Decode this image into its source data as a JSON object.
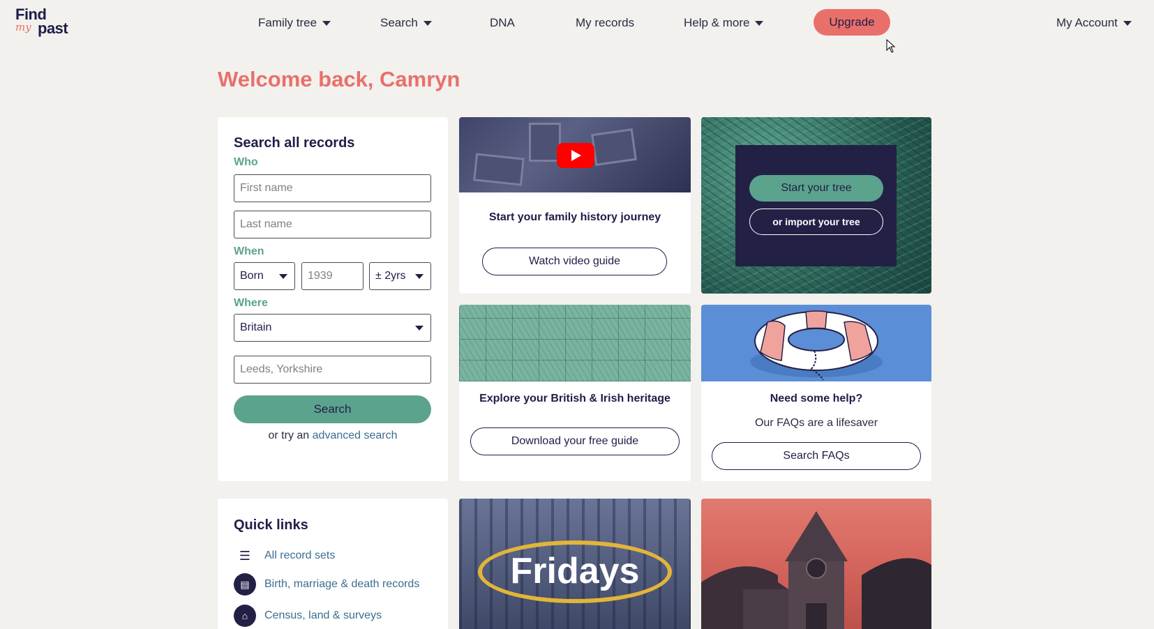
{
  "logo": {
    "line1": "Find",
    "line2": "my",
    "line3": "past"
  },
  "nav": {
    "items": [
      {
        "label": "Family tree",
        "dropdown": true
      },
      {
        "label": "Search",
        "dropdown": true
      },
      {
        "label": "DNA",
        "dropdown": false
      },
      {
        "label": "My records",
        "dropdown": false
      },
      {
        "label": "Help & more",
        "dropdown": true
      }
    ],
    "upgrade_label": "Upgrade",
    "account_label": "My Account"
  },
  "welcome": "Welcome back, Camryn",
  "search_card": {
    "title": "Search all records",
    "who_label": "Who",
    "first_name_placeholder": "First name",
    "last_name_placeholder": "Last name",
    "when_label": "When",
    "event_value": "Born",
    "year_placeholder": "1939",
    "range_value": "± 2yrs",
    "where_label": "Where",
    "country_value": "Britain",
    "location_placeholder": "Leeds, Yorkshire",
    "search_label": "Search",
    "advanced_prefix": "or try an",
    "advanced_link": "advanced search"
  },
  "video_card": {
    "title": "Start your family history journey",
    "button": "Watch video guide"
  },
  "tree_card": {
    "start_label": "Start your tree",
    "import_label": "or import your tree"
  },
  "heritage_card": {
    "title": "Explore your British & Irish heritage",
    "button": "Download your free guide"
  },
  "help_card": {
    "title": "Need some help?",
    "subtitle": "Our FAQs are a lifesaver",
    "button": "Search FAQs"
  },
  "quick_links": {
    "title": "Quick links",
    "items": [
      {
        "label": "All record sets",
        "icon": "list-icon"
      },
      {
        "label": "Birth, marriage & death records",
        "icon": "document-icon"
      },
      {
        "label": "Census, land & surveys",
        "icon": "house-icon"
      }
    ]
  },
  "fridays_card": {
    "text": "Fridays"
  },
  "colors": {
    "accent": "#e9706a",
    "brand_green": "#5ca38d",
    "navy": "#232046",
    "link": "#3a6e8f",
    "background": "#f2f1ee"
  }
}
